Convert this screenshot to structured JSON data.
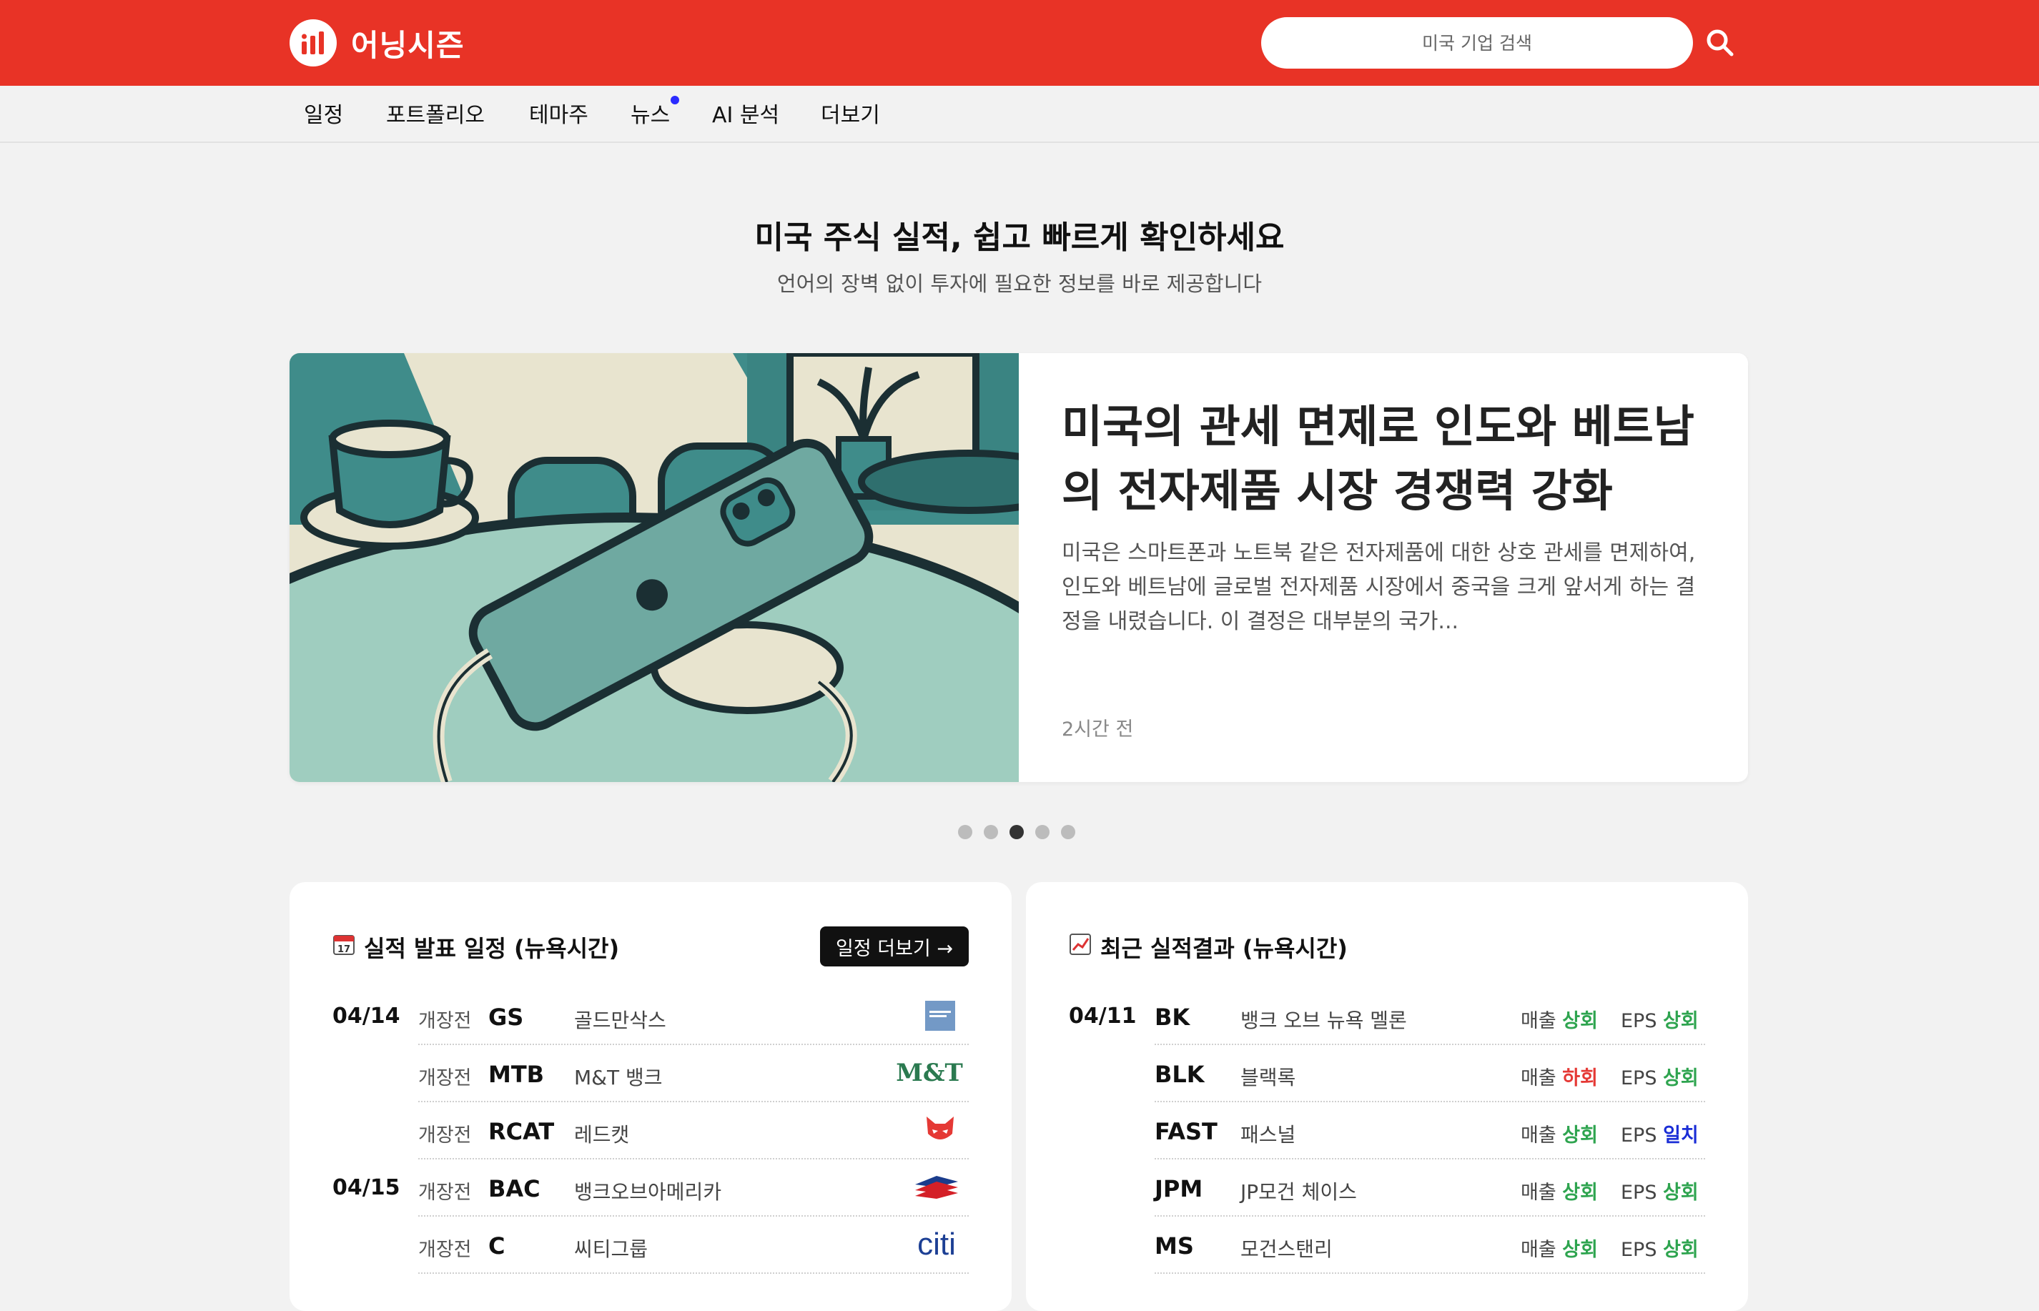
{
  "header": {
    "app_name": "어닝시즌",
    "search_placeholder": "미국 기업 검색"
  },
  "nav": {
    "items": [
      {
        "label": "일정"
      },
      {
        "label": "포트폴리오"
      },
      {
        "label": "테마주"
      },
      {
        "label": "뉴스",
        "has_new_dot": true
      },
      {
        "label": "AI 분석"
      },
      {
        "label": "더보기"
      }
    ]
  },
  "hero": {
    "title": "미국 주식 실적, 쉽고 빠르게 확인하세요",
    "subtitle": "언어의 장벽 없이 투자에 필요한 정보를 바로 제공합니다"
  },
  "featured": {
    "title": "미국의 관세 면제로 인도와 베트남의 전자제품 시장 경쟁력 강화",
    "description": "미국은 스마트폰과 노트북 같은 전자제품에 대한 상호 관세를 면제하여, 인도와 베트남에 글로벌 전자제품 시장에서 중국을 크게 앞서게 하는 결정을 내렸습니다. 이 결정은 대부분의 국가...",
    "time": "2시간 전",
    "slide_count": 5,
    "active_slide": 3
  },
  "schedule": {
    "icon": "calendar-icon",
    "title": "실적 발표 일정 (뉴욕시간)",
    "more_label": "일정 더보기 →",
    "rows": [
      {
        "date": "04/14",
        "timing": "개장전",
        "ticker": "GS",
        "name": "골드만삭스",
        "logo": "goldman-sachs-logo"
      },
      {
        "date": "",
        "timing": "개장전",
        "ticker": "MTB",
        "name": "M&T 뱅크",
        "logo": "mt-bank-logo",
        "logo_text": "M&T"
      },
      {
        "date": "",
        "timing": "개장전",
        "ticker": "RCAT",
        "name": "레드캣",
        "logo": "redcat-logo"
      },
      {
        "date": "04/15",
        "timing": "개장전",
        "ticker": "BAC",
        "name": "뱅크오브아메리카",
        "logo": "bank-of-america-logo"
      },
      {
        "date": "",
        "timing": "개장전",
        "ticker": "C",
        "name": "씨티그룹",
        "logo": "citi-logo",
        "logo_text": "citi"
      }
    ]
  },
  "results": {
    "icon": "chart-increasing-icon",
    "title": "최근 실적결과 (뉴욕시간)",
    "revenue_label": "매출",
    "eps_label": "EPS",
    "rows": [
      {
        "date": "04/11",
        "ticker": "BK",
        "name": "뱅크 오브 뉴욕 멜론",
        "revenue": "상회",
        "eps": "상회"
      },
      {
        "date": "",
        "ticker": "BLK",
        "name": "블랙록",
        "revenue": "하회",
        "eps": "상회"
      },
      {
        "date": "",
        "ticker": "FAST",
        "name": "패스널",
        "revenue": "상회",
        "eps": "일치"
      },
      {
        "date": "",
        "ticker": "JPM",
        "name": "JP모건 체이스",
        "revenue": "상회",
        "eps": "상회"
      },
      {
        "date": "",
        "ticker": "MS",
        "name": "모건스탠리",
        "revenue": "상회",
        "eps": "상회"
      }
    ],
    "colors": {
      "상회": "#2ea44f",
      "하회": "#e53935",
      "일치": "#1a2dd6"
    }
  }
}
